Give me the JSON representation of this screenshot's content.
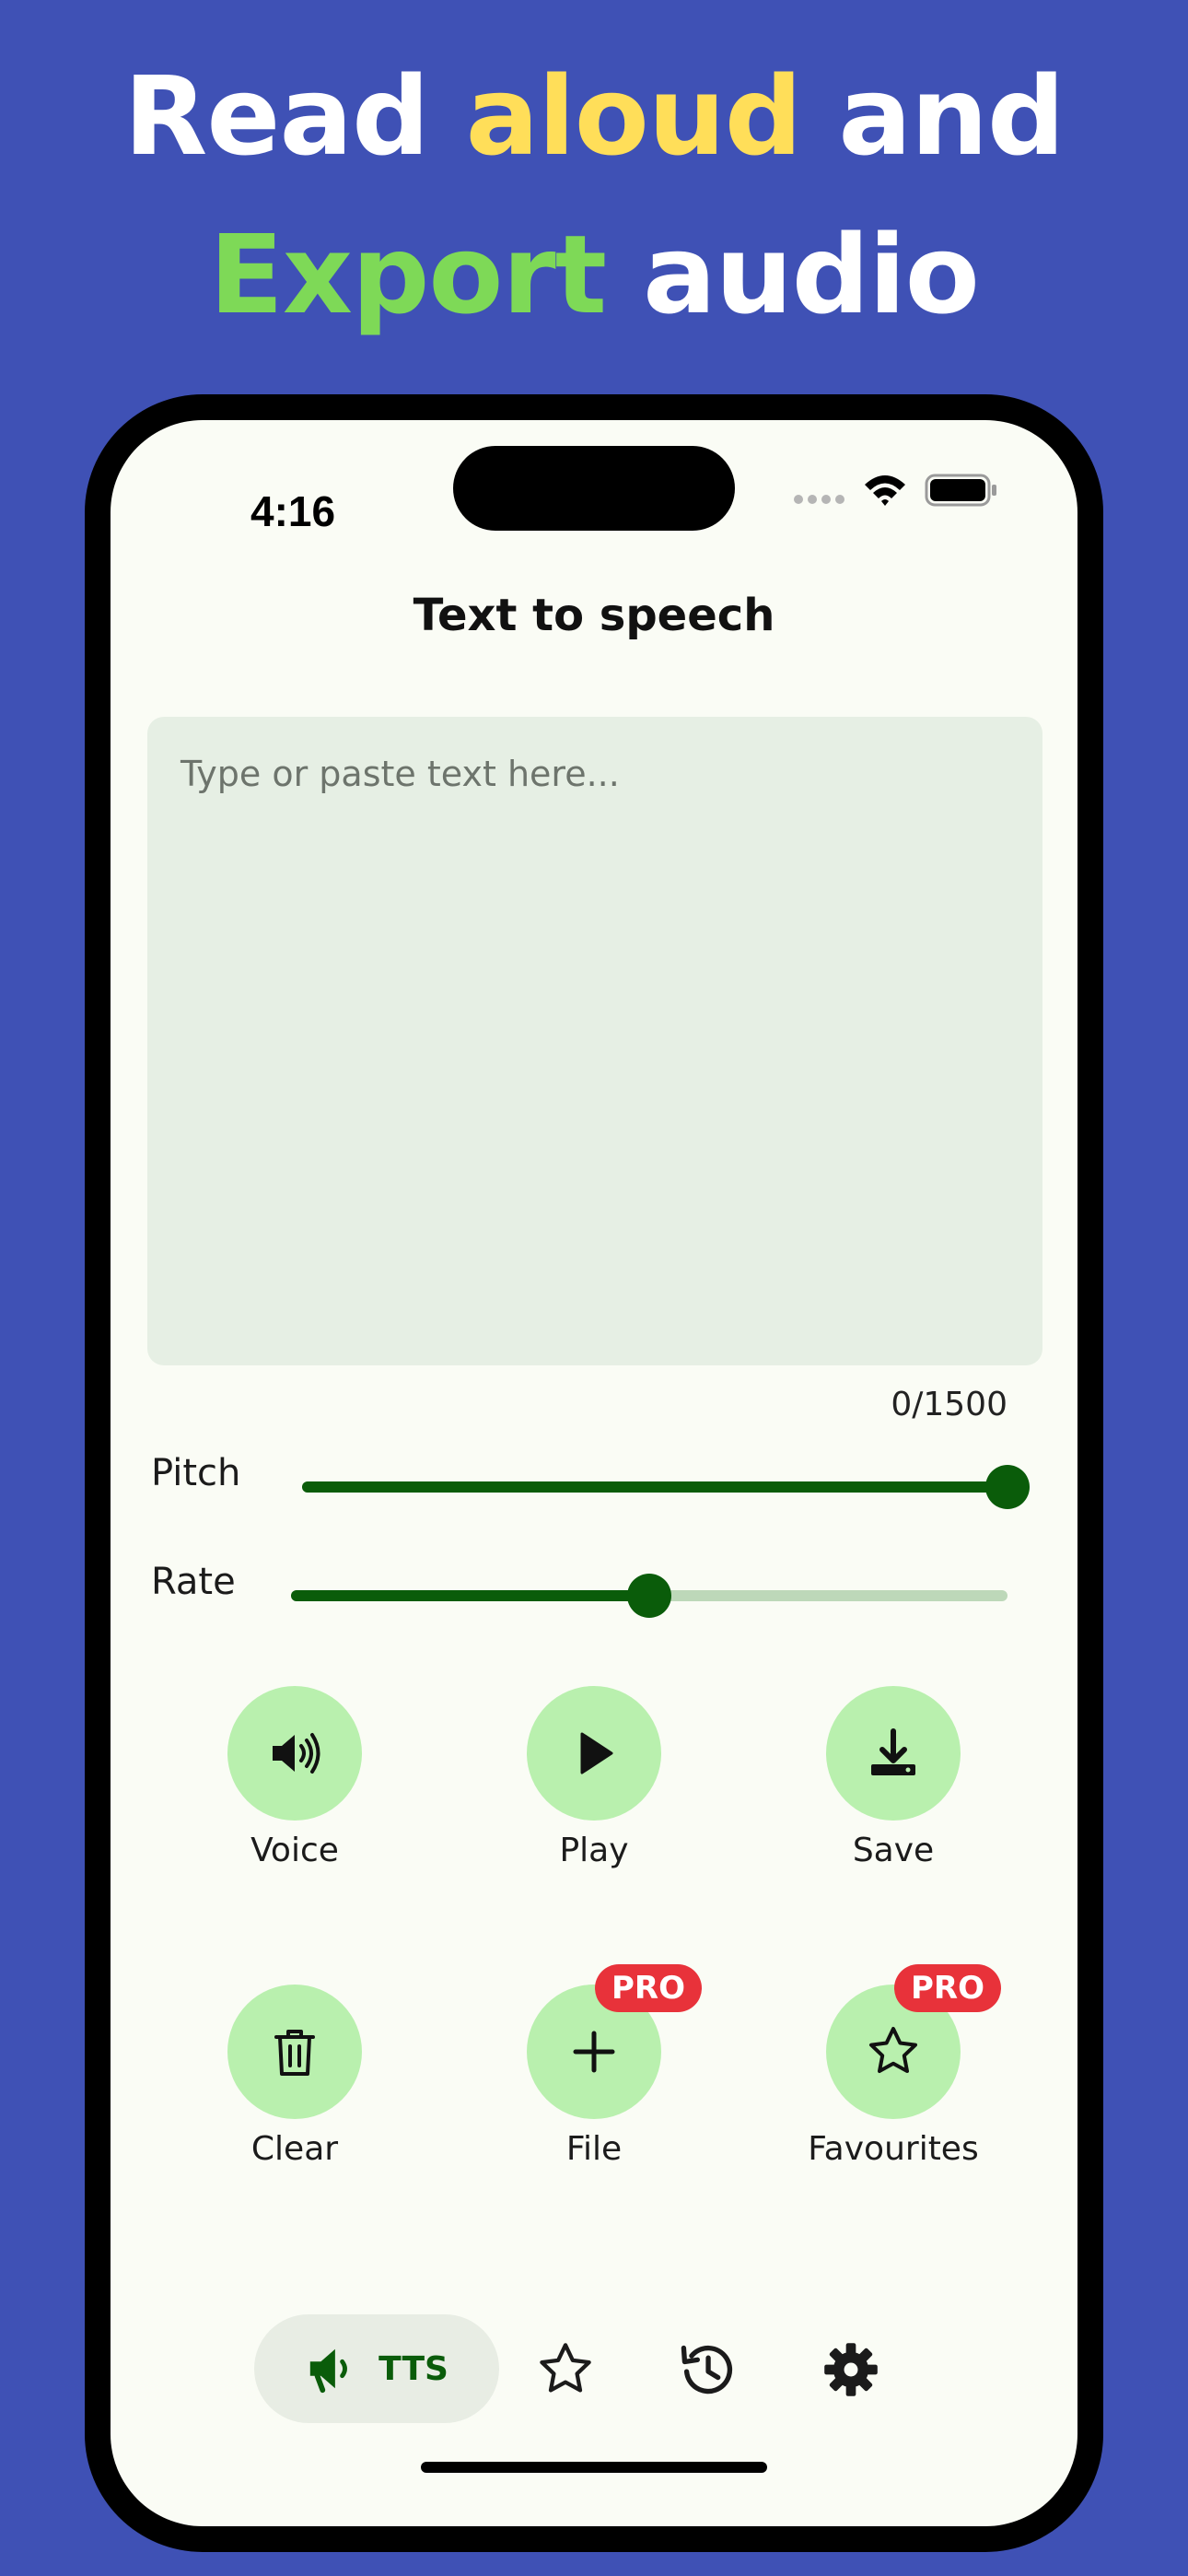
{
  "headline": {
    "line1": [
      {
        "text": "Read ",
        "color": "#ffffff"
      },
      {
        "text": "aloud",
        "color": "#ffde59"
      },
      {
        "text": " and",
        "color": "#ffffff"
      }
    ],
    "line2": [
      {
        "text": "Export",
        "color": "#7ed957"
      },
      {
        "text": " audio",
        "color": "#ffffff"
      }
    ]
  },
  "status_bar": {
    "time": "4:16",
    "icons": [
      "signal-icon",
      "wifi-icon",
      "battery-icon"
    ]
  },
  "app": {
    "title": "Text to speech"
  },
  "text_input": {
    "value": "",
    "placeholder": "Type or paste text here..."
  },
  "counter": "0/1500",
  "sliders": [
    {
      "label": "Pitch",
      "value": 1.0
    },
    {
      "label": "Rate",
      "value": 0.5
    }
  ],
  "actions": [
    {
      "label": "Voice",
      "icon": "speaker-icon"
    },
    {
      "label": "Play",
      "icon": "play-icon"
    },
    {
      "label": "Save",
      "icon": "download-icon"
    },
    {
      "label": "Clear",
      "icon": "trash-icon"
    },
    {
      "label": "File",
      "icon": "plus-icon",
      "badge": "PRO"
    },
    {
      "label": "Favourites",
      "icon": "star-icon",
      "badge": "PRO"
    }
  ],
  "bottom_nav": {
    "active_label": "TTS",
    "items": [
      "megaphone-icon",
      "star-icon",
      "history-icon",
      "gear-icon"
    ]
  },
  "colors": {
    "background": "#3f51b5",
    "accent": "#0a5c0a",
    "action_circle": "#b9f0ae",
    "pro_badge": "#e8323a"
  }
}
